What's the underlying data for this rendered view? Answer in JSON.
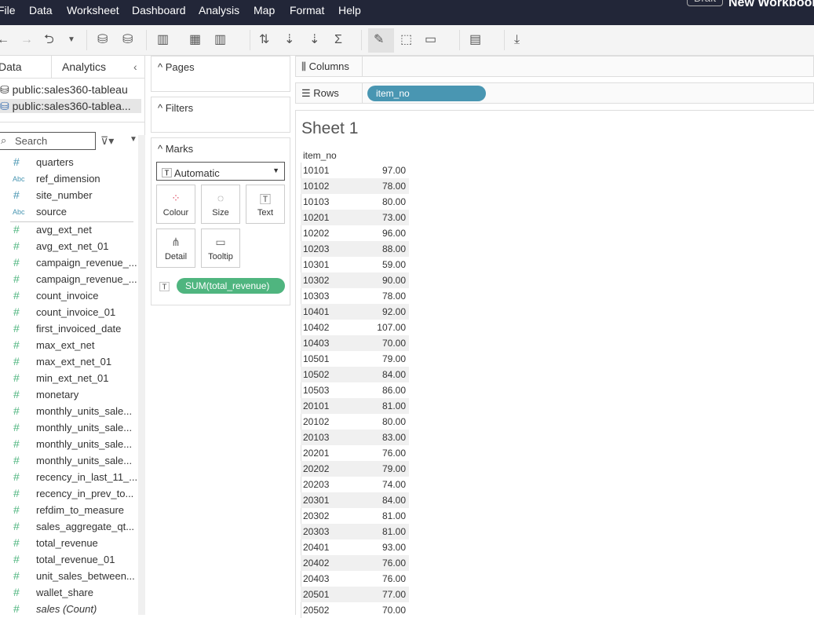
{
  "menu": [
    "File",
    "Data",
    "Worksheet",
    "Dashboard",
    "Analysis",
    "Map",
    "Format",
    "Help"
  ],
  "title": {
    "draft": "Draft",
    "workbook": "New Workbook"
  },
  "left": {
    "tabs": [
      "Data",
      "Analytics"
    ],
    "datasources": [
      "public:sales360-tableau",
      "public:sales360-tablea..."
    ],
    "search_placeholder": "Search",
    "fields": [
      {
        "name": "quarters",
        "type": "#",
        "kind": "dimension"
      },
      {
        "name": "ref_dimension",
        "type": "Abc",
        "kind": "dimension"
      },
      {
        "name": "site_number",
        "type": "#",
        "kind": "dimension"
      },
      {
        "name": "source",
        "type": "Abc",
        "kind": "dimension"
      },
      {
        "name": "avg_ext_net",
        "type": "#",
        "kind": "measure"
      },
      {
        "name": "avg_ext_net_01",
        "type": "#",
        "kind": "measure"
      },
      {
        "name": "campaign_revenue_...",
        "type": "#",
        "kind": "measure"
      },
      {
        "name": "campaign_revenue_...",
        "type": "#",
        "kind": "measure"
      },
      {
        "name": "count_invoice",
        "type": "#",
        "kind": "measure"
      },
      {
        "name": "count_invoice_01",
        "type": "#",
        "kind": "measure"
      },
      {
        "name": "first_invoiced_date",
        "type": "#",
        "kind": "measure"
      },
      {
        "name": "max_ext_net",
        "type": "#",
        "kind": "measure"
      },
      {
        "name": "max_ext_net_01",
        "type": "#",
        "kind": "measure"
      },
      {
        "name": "min_ext_net_01",
        "type": "#",
        "kind": "measure"
      },
      {
        "name": "monetary",
        "type": "#",
        "kind": "measure"
      },
      {
        "name": "monthly_units_sale...",
        "type": "#",
        "kind": "measure"
      },
      {
        "name": "monthly_units_sale...",
        "type": "#",
        "kind": "measure"
      },
      {
        "name": "monthly_units_sale...",
        "type": "#",
        "kind": "measure"
      },
      {
        "name": "monthly_units_sale...",
        "type": "#",
        "kind": "measure"
      },
      {
        "name": "recency_in_last_11_...",
        "type": "#",
        "kind": "measure"
      },
      {
        "name": "recency_in_prev_to...",
        "type": "#",
        "kind": "measure"
      },
      {
        "name": "refdim_to_measure",
        "type": "#",
        "kind": "measure"
      },
      {
        "name": "sales_aggregate_qt...",
        "type": "#",
        "kind": "measure"
      },
      {
        "name": "total_revenue",
        "type": "#",
        "kind": "measure"
      },
      {
        "name": "total_revenue_01",
        "type": "#",
        "kind": "measure"
      },
      {
        "name": "unit_sales_between...",
        "type": "#",
        "kind": "measure"
      },
      {
        "name": "wallet_share",
        "type": "#",
        "kind": "measure"
      },
      {
        "name": "sales (Count)",
        "type": "#",
        "kind": "measure"
      }
    ]
  },
  "cards": {
    "pages": "Pages",
    "filters": "Filters",
    "marks": "Marks",
    "mark_type": "Automatic",
    "mark_buttons": [
      "Colour",
      "Size",
      "Text",
      "Detail",
      "Tooltip"
    ],
    "marks_pill": "SUM(total_revenue)"
  },
  "shelves": {
    "columns": "Columns",
    "rows": "Rows",
    "rows_pill": "item_no"
  },
  "colors": {
    "dimension": "#4996b2",
    "measure": "#4fb57f",
    "menubar": "#222638"
  },
  "sheet": {
    "title": "Sheet 1",
    "column_header": "item_no",
    "rows": [
      [
        "10101",
        "97.00"
      ],
      [
        "10102",
        "78.00"
      ],
      [
        "10103",
        "80.00"
      ],
      [
        "10201",
        "73.00"
      ],
      [
        "10202",
        "96.00"
      ],
      [
        "10203",
        "88.00"
      ],
      [
        "10301",
        "59.00"
      ],
      [
        "10302",
        "90.00"
      ],
      [
        "10303",
        "78.00"
      ],
      [
        "10401",
        "92.00"
      ],
      [
        "10402",
        "107.00"
      ],
      [
        "10403",
        "70.00"
      ],
      [
        "10501",
        "79.00"
      ],
      [
        "10502",
        "84.00"
      ],
      [
        "10503",
        "86.00"
      ],
      [
        "20101",
        "81.00"
      ],
      [
        "20102",
        "80.00"
      ],
      [
        "20103",
        "83.00"
      ],
      [
        "20201",
        "76.00"
      ],
      [
        "20202",
        "79.00"
      ],
      [
        "20203",
        "74.00"
      ],
      [
        "20301",
        "84.00"
      ],
      [
        "20302",
        "81.00"
      ],
      [
        "20303",
        "81.00"
      ],
      [
        "20401",
        "93.00"
      ],
      [
        "20402",
        "76.00"
      ],
      [
        "20403",
        "76.00"
      ],
      [
        "20501",
        "77.00"
      ],
      [
        "20502",
        "70.00"
      ]
    ]
  }
}
